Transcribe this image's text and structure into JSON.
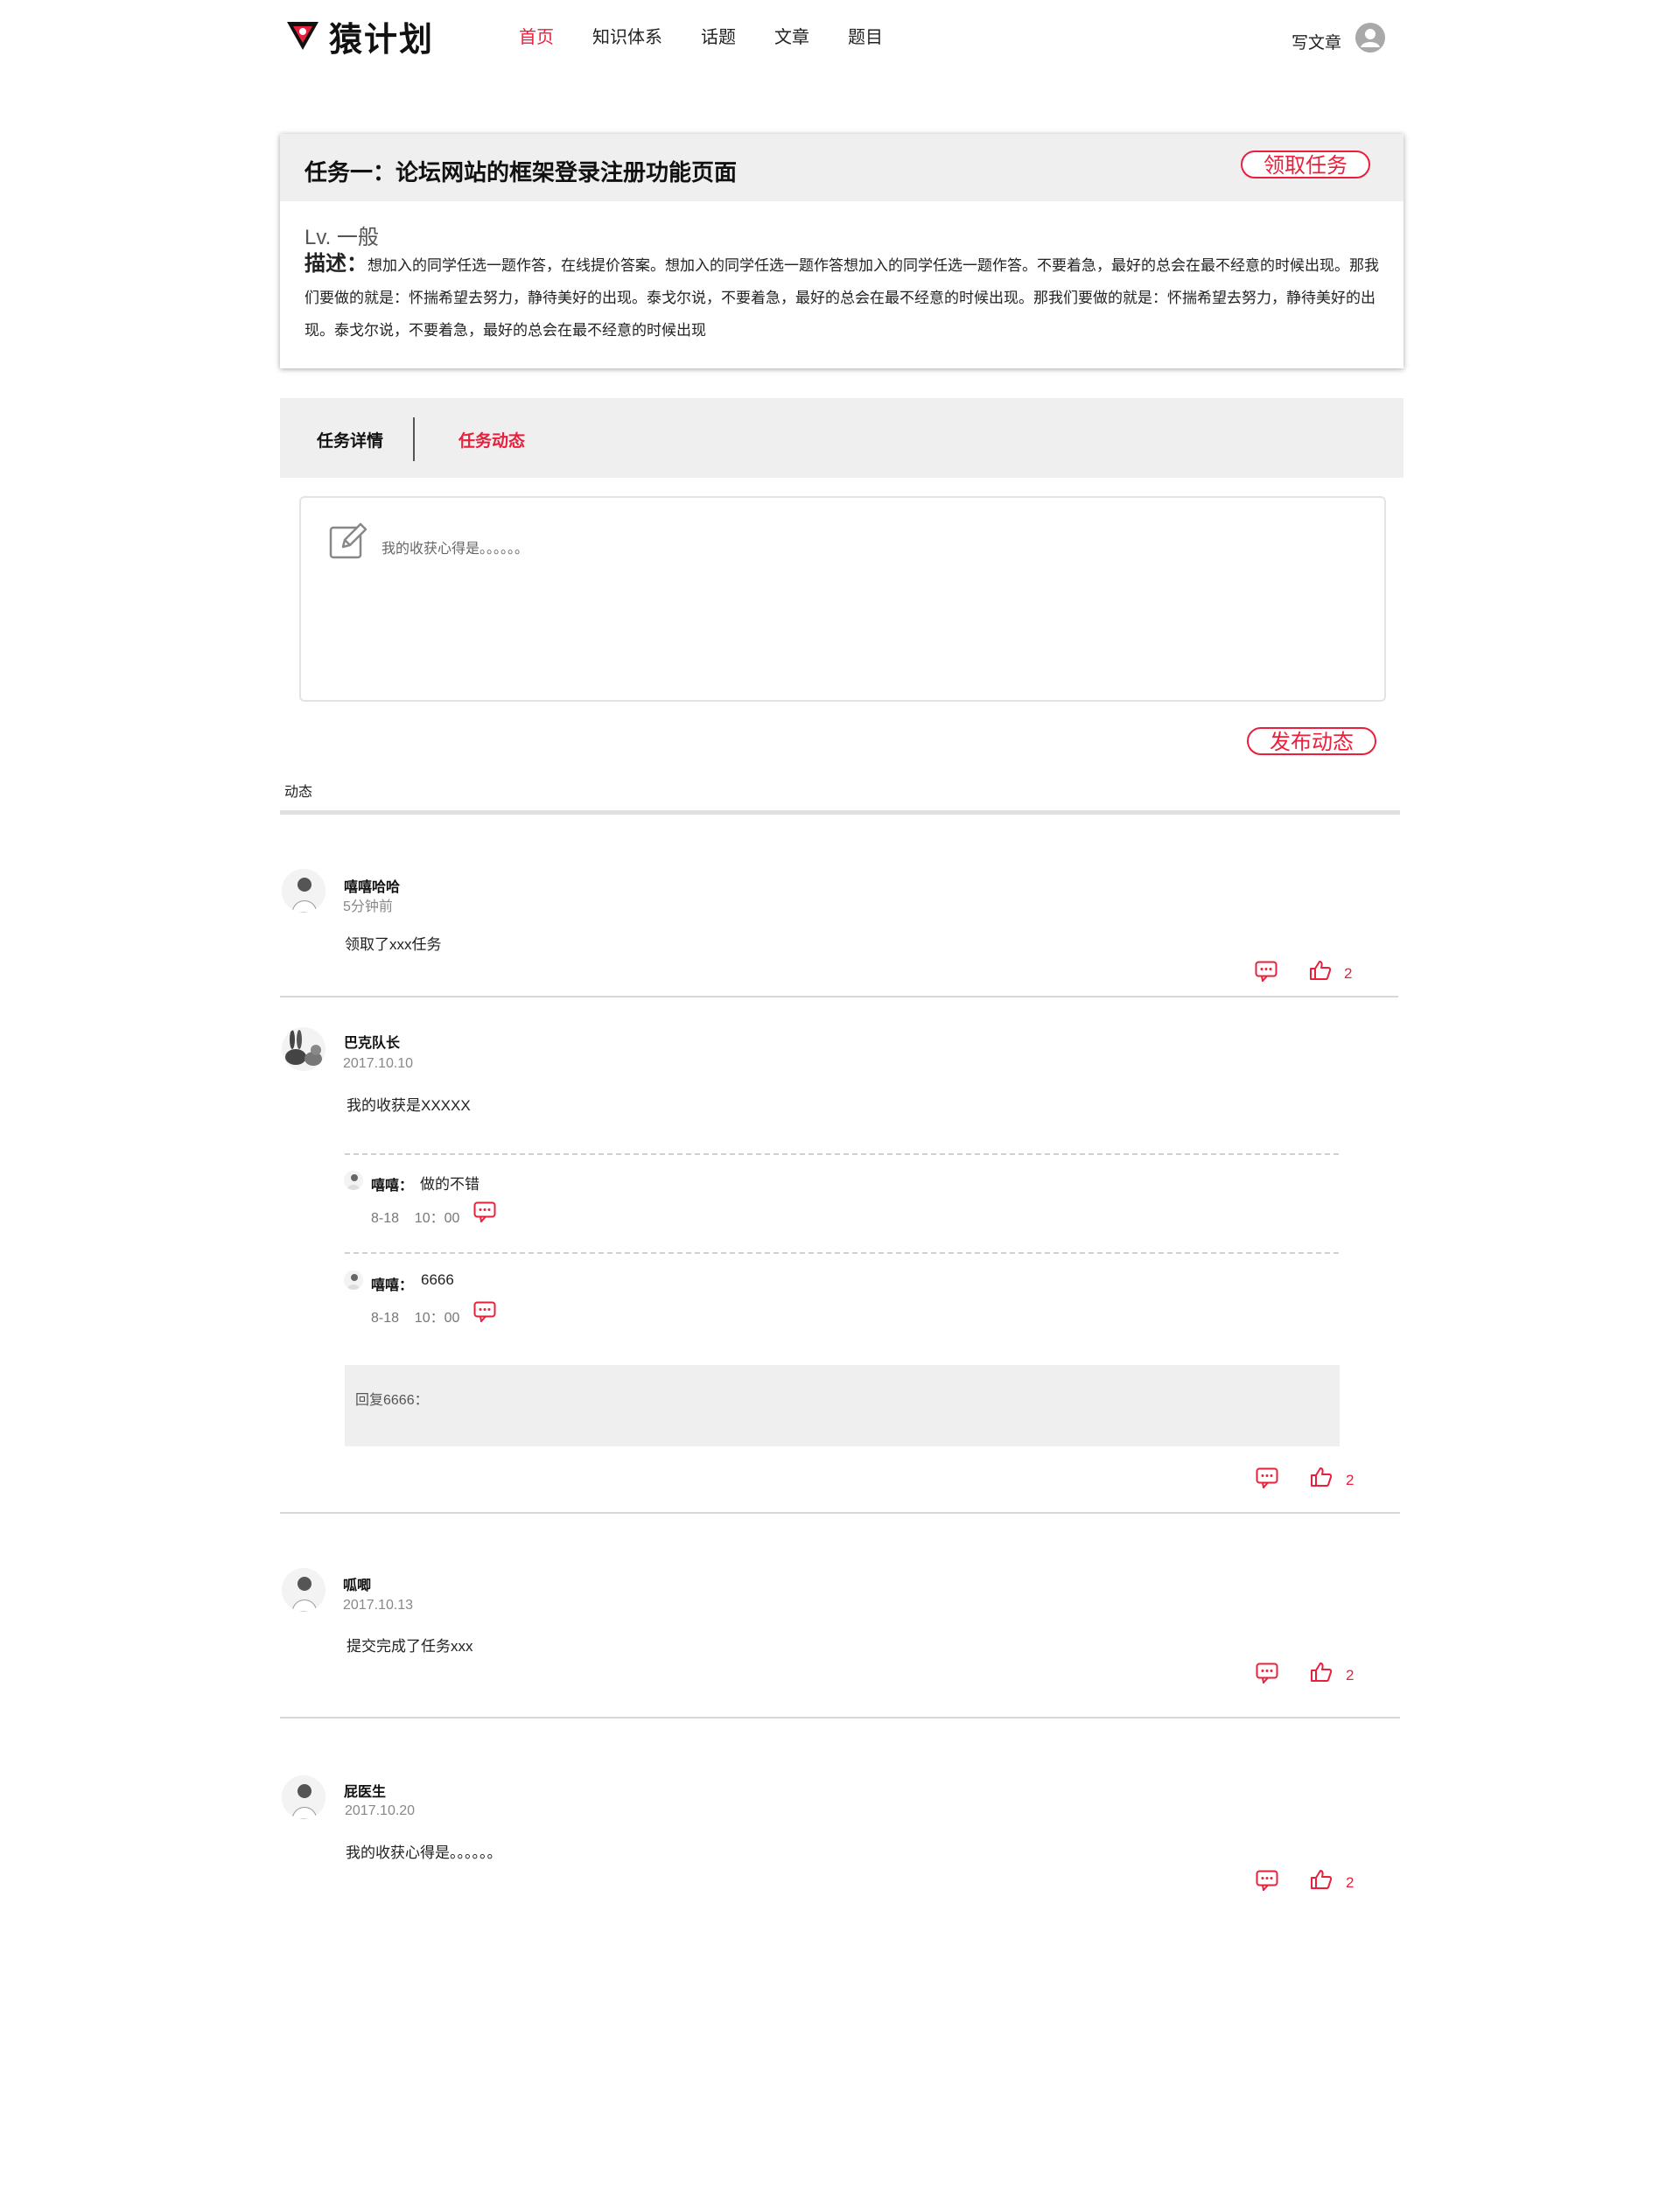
{
  "header": {
    "logo_text": "猿计划",
    "nav": [
      {
        "label": "首页",
        "active": true
      },
      {
        "label": "知识体系",
        "active": false
      },
      {
        "label": "话题",
        "active": false
      },
      {
        "label": "文章",
        "active": false
      },
      {
        "label": "题目",
        "active": false
      }
    ],
    "write_label": "写文章"
  },
  "task": {
    "title": "任务一：论坛网站的框架登录注册功能页面",
    "claim_label": "领取任务",
    "level": "Lv.  一般",
    "desc_label": "描述：",
    "desc_text": "想加入的同学任选一题作答，在线提价答案。想加入的同学任选一题作答想加入的同学任选一题作答。不要着急，最好的总会在最不经意的时候出现。那我们要做的就是：怀揣希望去努力，静待美好的出现。泰戈尔说，不要着急，最好的总会在最不经意的时候出现。那我们要做的就是：怀揣希望去努力，静待美好的出现。泰戈尔说，不要着急，最好的总会在最不经意的时候出现"
  },
  "tabs": {
    "detail": "任务详情",
    "activity": "任务动态"
  },
  "editor": {
    "placeholder": "我的收获心得是。。。。。。"
  },
  "publish_label": "发布动态",
  "activity_label": "动态",
  "posts": [
    {
      "name": "嘻嘻哈哈",
      "time": "5分钟前",
      "content": "领取了xxx任务",
      "likes": "2"
    },
    {
      "name": "巴克队长",
      "time": "2017.10.10",
      "content": "我的收获是XXXXX",
      "likes": "2",
      "replies": [
        {
          "name": "嘻嘻：",
          "text": "做的不错",
          "time": "8-18    10：00"
        },
        {
          "name": "嘻嘻：",
          "text": "6666",
          "time": "8-18    10：00"
        }
      ],
      "reply_box": "回复6666："
    },
    {
      "name": "呱唧",
      "time": "2017.10.13",
      "content": "提交完成了任务xxx",
      "likes": "2"
    },
    {
      "name": "屁医生",
      "time": "2017.10.20",
      "content": "我的收获心得是。。。。。。",
      "likes": "2"
    }
  ],
  "colors": {
    "accent": "#e8203c",
    "panel": "#efefef"
  }
}
